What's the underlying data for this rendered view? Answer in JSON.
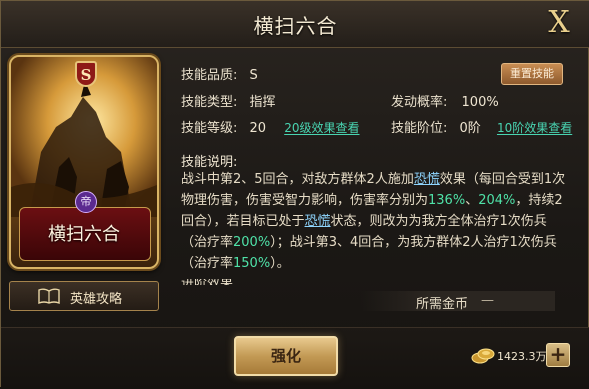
{
  "header": {
    "title": "横扫六合",
    "close_label": "X"
  },
  "card": {
    "grade": "S",
    "name": "横扫六合",
    "type_symbol": "帝"
  },
  "guide_button": {
    "label": "英雄攻略"
  },
  "skill": {
    "quality_label": "技能品质:",
    "quality_value": "S",
    "type_label": "技能类型:",
    "type_value": "指挥",
    "level_label": "技能等级:",
    "level_value": "20",
    "level_link": "20级效果查看",
    "rate_label": "发动概率:",
    "rate_value": "100%",
    "stage_label": "技能阶位:",
    "stage_value": "0阶",
    "stage_link": "10阶效果查看",
    "reset_button": "重置技能"
  },
  "description": {
    "title": "技能说明:",
    "p1": "战斗中第2、5回合，对敌方群体2人施加",
    "kw1": "恐慌",
    "p2": "效果（每回合受到1次物理伤害，伤害受智力影响，伤害率分别为",
    "v1": "136%",
    "p3": "、",
    "v2": "204%",
    "p4": "，持续2回合），若目标已处于",
    "kw2": "恐慌",
    "p5": "状态，则改为为我方全体治疗1次伤兵（治疗率",
    "v3": "200%",
    "p6": "）；战斗第3、4回合，为我方群体2人治疗1次伤兵（治疗率",
    "v4": "150%",
    "p7": "）。",
    "cut_line": "进阶效果"
  },
  "cost": {
    "label": "所需金币",
    "value": "—"
  },
  "bottom": {
    "strength_button": "强化",
    "coin_amount": "1423.3万",
    "add_label": "+"
  }
}
